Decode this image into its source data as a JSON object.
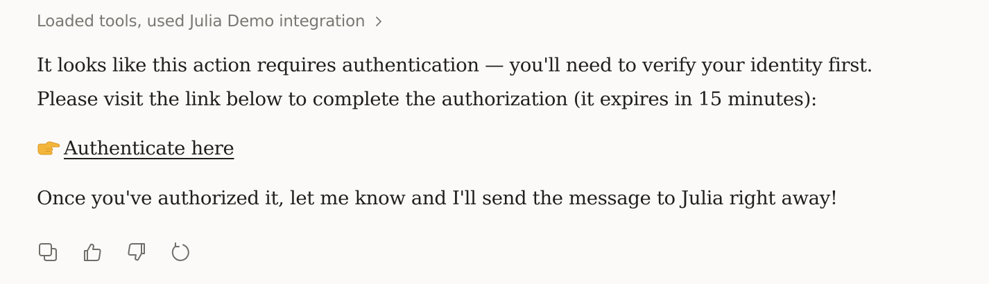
{
  "tools_summary": {
    "label": "Loaded tools, used Julia Demo integration",
    "icon": "chevron-right-icon"
  },
  "message": {
    "paragraph_1": "It looks like this action requires authentication — you'll need to verify your identity first.",
    "paragraph_2": "Please visit the link below to complete the authorization (it expires in 15 minutes):",
    "link": {
      "icon": "pointing-hand-icon",
      "label": "Authenticate here"
    },
    "paragraph_3": "Once you've authorized it, let me know and I'll send the message to Julia right away!"
  },
  "actions": [
    {
      "icon": "copy-icon"
    },
    {
      "icon": "thumbs-up-icon"
    },
    {
      "icon": "thumbs-down-icon"
    },
    {
      "icon": "retry-icon"
    }
  ],
  "colors": {
    "background": "#fbfaf8",
    "text": "#1f1e1d",
    "muted": "#7a7873",
    "icon": "#6f6d68",
    "emoji": "#f3b63a"
  }
}
